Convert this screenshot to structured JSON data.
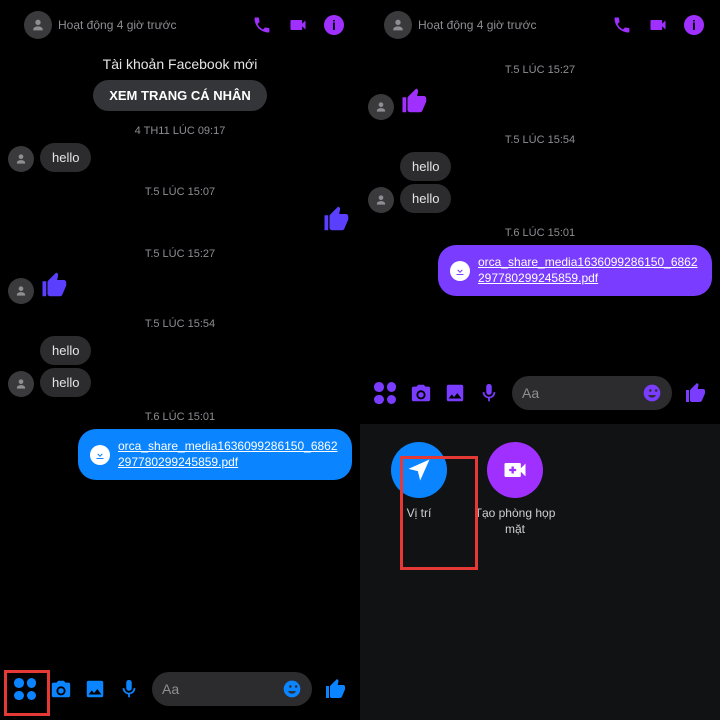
{
  "header": {
    "activity": "Hoạt động 4 giờ trước",
    "facebook_title": "Tài khoản Facebook mới",
    "view_profile_btn": "XEM TRANG CÁ NHÂN"
  },
  "timestamps": {
    "a": "4 TH11 LÚC 09:17",
    "b": "T.5 LÚC 15:07",
    "c": "T.5 LÚC 15:27",
    "d": "T.5 LÚC 15:54",
    "e": "T.6 LÚC 15:01"
  },
  "msgs": {
    "hello": "hello",
    "file_name": "orca_share_media1636099286150_6862297780299245859.pdf"
  },
  "composer": {
    "placeholder": "Aa"
  },
  "drawer": {
    "location_label": "Vị trí",
    "room_label": "Tạo phòng họp mặt"
  },
  "colors": {
    "accent_left": "#0a84ff",
    "accent_right": "#7a3cff",
    "purple": "#a030ff",
    "highlight": "#e53935"
  }
}
